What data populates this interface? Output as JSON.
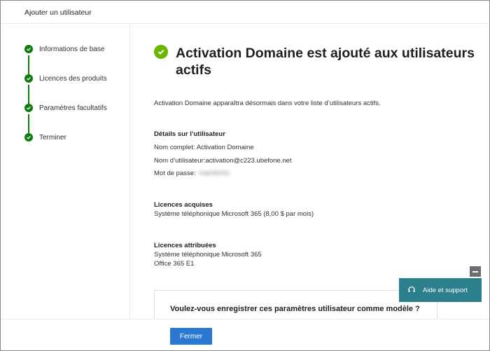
{
  "panel": {
    "title": "Ajouter un utilisateur"
  },
  "steps": [
    {
      "label": "Informations de base"
    },
    {
      "label": "Licences des produits"
    },
    {
      "label": "Paramètres facultatifs"
    },
    {
      "label": "Terminer"
    }
  ],
  "success": {
    "headline": "Activation Domaine est ajouté aux utilisateurs actifs",
    "intro": "Activation Domaine apparaîtra désormais dans votre liste d’utilisateurs actifs."
  },
  "user_details": {
    "title": "Détails sur l’utilisateur",
    "full_name": "Nom complet: Activation Domaine",
    "username": "Nom d’utilisateur:activation@c223.ubefone.net",
    "password_label": "Mot de passe:",
    "password_value": "Hab08453"
  },
  "licenses_acquired": {
    "title": "Licences acquises",
    "items": [
      "Système téléphonique Microsoft 365 (8,00 $ par mois)"
    ]
  },
  "licenses_assigned": {
    "title": "Licences attribuées",
    "items": [
      "Système téléphonique Microsoft 365",
      "Office 365 E1"
    ]
  },
  "template": {
    "question": "Voulez-vous enregistrer ces paramètres utilisateur comme modèle ?"
  },
  "footer": {
    "close_label": "Fermer"
  },
  "help": {
    "label": "Aide et support",
    "icon": "headset-icon"
  },
  "colors": {
    "step_green": "#107c10",
    "success_green": "#6bb700",
    "primary": "#2b78d1",
    "help_teal": "#2c7f8c"
  }
}
